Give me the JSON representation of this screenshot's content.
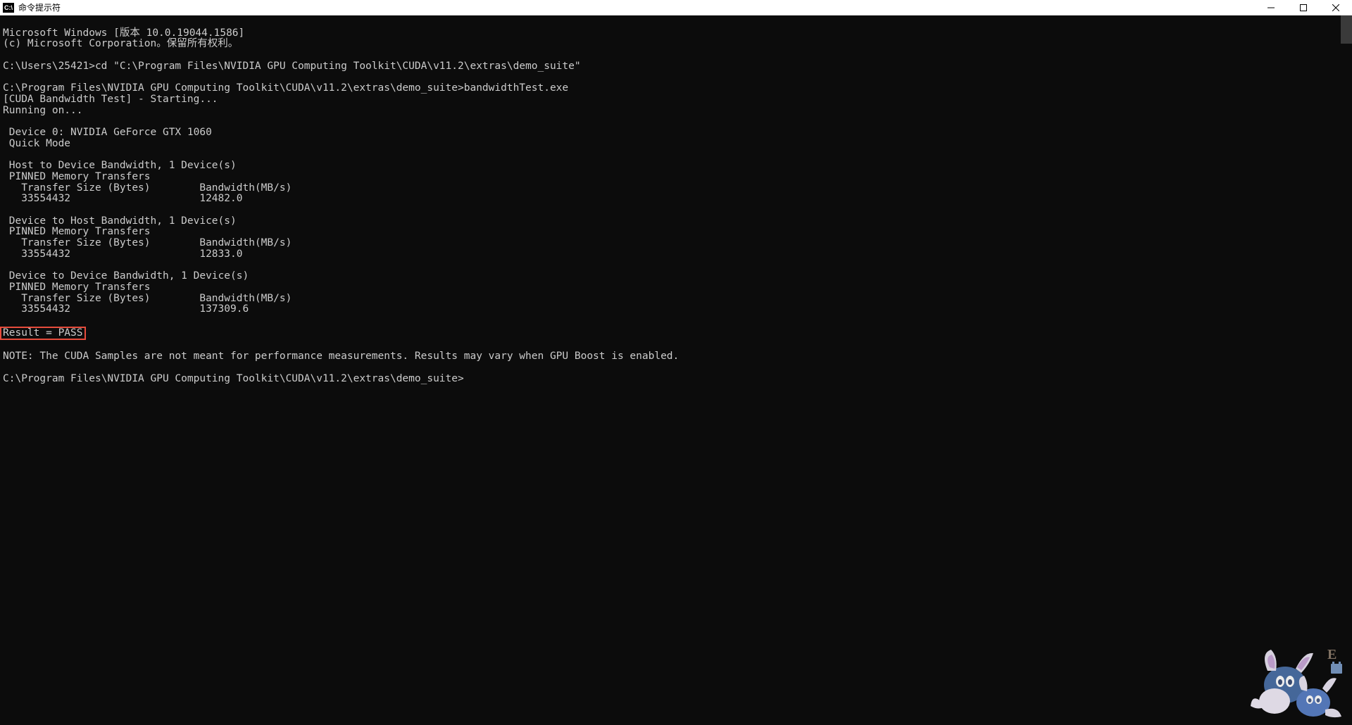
{
  "window": {
    "title": "命令提示符",
    "icon_label": "C:\\"
  },
  "terminal": {
    "line1": "Microsoft Windows [版本 10.0.19044.1586]",
    "line2": "(c) Microsoft Corporation。保留所有权利。",
    "blank1": "",
    "line3": "C:\\Users\\25421>cd \"C:\\Program Files\\NVIDIA GPU Computing Toolkit\\CUDA\\v11.2\\extras\\demo_suite\"",
    "blank2": "",
    "line4": "C:\\Program Files\\NVIDIA GPU Computing Toolkit\\CUDA\\v11.2\\extras\\demo_suite>bandwidthTest.exe",
    "line5": "[CUDA Bandwidth Test] - Starting...",
    "line6": "Running on...",
    "blank3": "",
    "line7": " Device 0: NVIDIA GeForce GTX 1060",
    "line8": " Quick Mode",
    "blank4": "",
    "line9": " Host to Device Bandwidth, 1 Device(s)",
    "line10": " PINNED Memory Transfers",
    "line11": "   Transfer Size (Bytes)        Bandwidth(MB/s)",
    "line12": "   33554432                     12482.0",
    "blank5": "",
    "line13": " Device to Host Bandwidth, 1 Device(s)",
    "line14": " PINNED Memory Transfers",
    "line15": "   Transfer Size (Bytes)        Bandwidth(MB/s)",
    "line16": "   33554432                     12833.0",
    "blank6": "",
    "line17": " Device to Device Bandwidth, 1 Device(s)",
    "line18": " PINNED Memory Transfers",
    "line19": "   Transfer Size (Bytes)        Bandwidth(MB/s)",
    "line20": "   33554432                     137309.6",
    "blank7": "",
    "result": "Result = PASS",
    "blank8": "",
    "note": "NOTE: The CUDA Samples are not meant for performance measurements. Results may vary when GPU Boost is enabled.",
    "blank9": "",
    "prompt": "C:\\Program Files\\NVIDIA GPU Computing Toolkit\\CUDA\\v11.2\\extras\\demo_suite>"
  },
  "mascot": {
    "letter": "E"
  }
}
